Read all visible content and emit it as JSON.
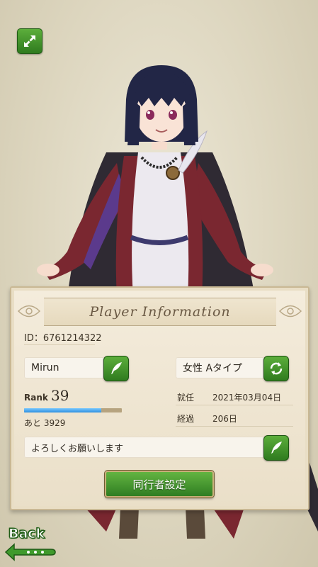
{
  "panel": {
    "title": "Player Information",
    "player_id": "ID：6761214322",
    "name": "Mirun",
    "gender_type": "女性 Aタイプ",
    "rank_label": "Rank",
    "rank_value": "39",
    "xp_fraction": 0.79,
    "remaining": "あと 3929",
    "appointed_label": "就任",
    "appointed_value": "2021年03月04日",
    "elapsed_label": "経過",
    "elapsed_value": "206日",
    "greeting": "よろしくお願いします",
    "companion_button": "同行者設定"
  },
  "nav": {
    "back_label": "Back"
  },
  "icons": {
    "expand": "expand-icon",
    "quill": "quill-icon",
    "refresh": "refresh-icon",
    "back_arrow": "arrow-left-icon"
  },
  "colors": {
    "button_green": "#3f9a2c",
    "xp_blue": "#3a9cf0",
    "parchment": "#f1e8d6"
  }
}
